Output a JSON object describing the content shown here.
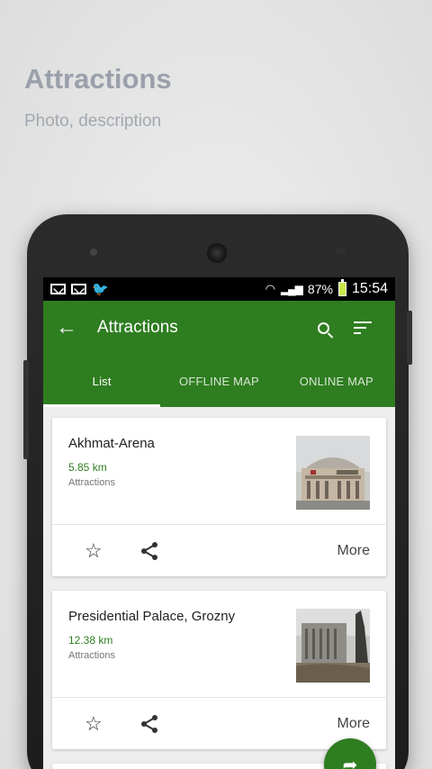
{
  "promo": {
    "title": "Attractions",
    "subtitle": "Photo, description"
  },
  "status_bar": {
    "notification_icons": [
      "mail-icon",
      "mail-icon",
      "twitter-bird-icon"
    ],
    "battery": "87%",
    "time": "15:54"
  },
  "toolbar": {
    "title": "Attractions",
    "back_icon": "arrow-left-icon",
    "search_icon": "search-icon",
    "sort_icon": "sort-icon"
  },
  "tabs": [
    {
      "label": "List"
    },
    {
      "label": "OFFLINE MAP"
    },
    {
      "label": "ONLINE MAP"
    }
  ],
  "items": [
    {
      "name": "Akhmat-Arena",
      "distance": "5.85 km",
      "category": "Attractions",
      "more_label": "More"
    },
    {
      "name": "Presidential Palace, Grozny",
      "distance": "12.38 km",
      "category": "Attractions",
      "more_label": "More"
    }
  ],
  "colors": {
    "primary": "#2f7d21",
    "promo_text": "#9aa0ab"
  }
}
